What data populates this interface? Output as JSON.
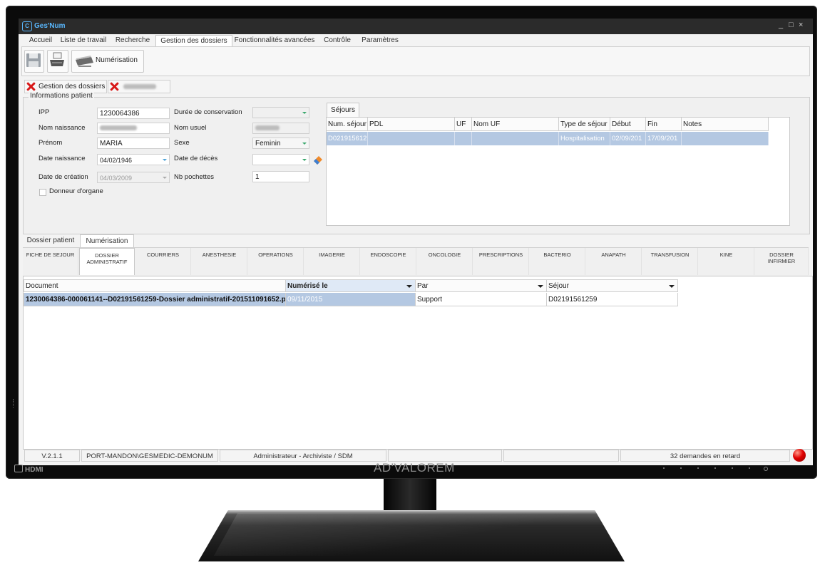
{
  "app": {
    "title": "Ges'Num",
    "logo": "C"
  },
  "window_controls": {
    "minimize": "_",
    "maximize": "□",
    "close": "×"
  },
  "menu": [
    {
      "label": "Accueil"
    },
    {
      "label": "Liste de travail"
    },
    {
      "label": "Recherche"
    },
    {
      "label": "Gestion des dossiers"
    },
    {
      "label": "Fonctionnalités avancées"
    },
    {
      "label": "Contrôle"
    },
    {
      "label": "Paramètres"
    }
  ],
  "toolbar": {
    "numerisation_label": "Numérisation",
    "save_icon": "floppy-disk-icon",
    "print_icon": "printer-icon",
    "scan_icon": "scanner-icon"
  },
  "doc_tabs": {
    "gestion_label": "Gestion des dossiers"
  },
  "patient": {
    "legend": "Informations patient",
    "labels": {
      "ipp": "IPP",
      "nom_naissance": "Nom naissance",
      "prenom": "Prénom",
      "date_naissance": "Date naissance",
      "date_creation": "Date de création",
      "duree": "Durée de conservation",
      "nom_usuel": "Nom usuel",
      "sexe": "Sexe",
      "date_deces": "Date de décès",
      "nb_pochettes": "Nb pochettes",
      "donneur": "Donneur d'organe"
    },
    "values": {
      "ipp": "1230064386",
      "prenom": "MARIA",
      "date_naissance": "04/02/1946",
      "date_creation": "04/03/2009",
      "sexe": "Feminin",
      "nb_pochettes": "1"
    }
  },
  "sejours": {
    "tab_label": "Séjours",
    "columns": [
      "Num. séjour",
      "PDL",
      "UF",
      "Nom UF",
      "Type de séjour",
      "Début",
      "Fin",
      "Notes"
    ],
    "rows": [
      [
        "D021915612",
        "",
        "",
        "",
        "Hospitalisation",
        "02/09/201",
        "17/09/201",
        ""
      ]
    ]
  },
  "sub_tabs": [
    {
      "label": "Dossier patient"
    },
    {
      "label": "Numérisation"
    }
  ],
  "categories": [
    "FICHE DE SEJOUR",
    "DOSSIER ADMINISTRATIF",
    "COURRIERS",
    "ANESTHESIE",
    "OPERATIONS",
    "IMAGERIE",
    "ENDOSCOPIE",
    "ONCOLOGIE",
    "PRESCRIPTIONS",
    "BACTERIO",
    "ANAPATH",
    "TRANSFUSION",
    "KINE",
    "DOSSIER INFIRMIER"
  ],
  "documents": {
    "columns": [
      "Document",
      "Numérisé le",
      "Par",
      "Séjour"
    ],
    "rows": [
      [
        "1230064386-000061141--D02191561259-Dossier administratif-201511091652.p",
        "09/11/2015",
        "Support",
        "D02191561259"
      ]
    ]
  },
  "status": {
    "version": "V.2.1.1",
    "host": "PORT-MANDON\\GESMEDIC-DEMONUM",
    "role": "Administrateur - Archiviste / SDM",
    "late": "32 demandes en retard"
  },
  "monitor": {
    "brand": "AD'VALOREM",
    "port": "HDMI"
  },
  "colors": {
    "selection": "#b4c8e2",
    "accent": "#59b8ff",
    "alert": "#e00000"
  }
}
